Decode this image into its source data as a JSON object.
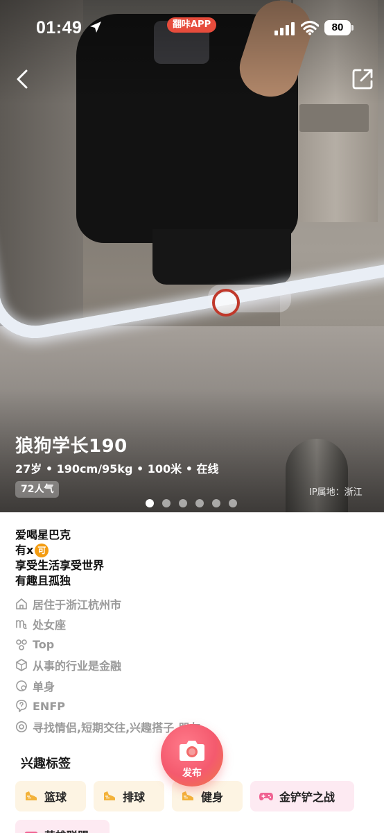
{
  "status_bar": {
    "time": "01:49",
    "app_pill": "翻咔APP",
    "battery": "80"
  },
  "profile": {
    "name": "狼狗学长190",
    "meta": "27岁 • 190cm/95kg • 100米 • 在线",
    "popularity": "72人气",
    "ip_location": "IP属地：浙江",
    "photo_count": 6,
    "photo_active_index": 0
  },
  "bio": {
    "line1": "爱喝星巴克",
    "line2_prefix": "有x",
    "line2_emoji": "可",
    "line3": "享受生活享受世界",
    "line4": "有趣且孤独"
  },
  "info": {
    "residence": "居住于浙江杭州市",
    "zodiac": "处女座",
    "role": "Top",
    "industry": "从事的行业是金融",
    "relationship": "单身",
    "mbti": "ENFP",
    "looking_for": "寻找情侣,短期交往,兴趣搭子,朋友"
  },
  "interests": {
    "title": "兴趣标签",
    "tags": [
      "篮球",
      "排球",
      "健身",
      "金铲铲之战",
      "英雄联盟"
    ]
  },
  "fab": {
    "label": "发布"
  },
  "colors": {
    "accent": "#f45a6e",
    "status_pill": "#e74c3c",
    "sport_tag_bg": "#fdf4e3",
    "game_tag_bg": "#fdeaf2",
    "muted_text": "#9a9a9a"
  },
  "icons": {
    "back": "chevron-left-icon",
    "share": "share-icon",
    "residence": "home-icon",
    "zodiac": "virgo-icon",
    "role": "role-icon",
    "industry": "industry-icon",
    "relationship": "heart-status-icon",
    "mbti": "question-bubble-icon",
    "looking_for": "target-icon",
    "sport": "sneaker-icon",
    "game": "gamepad-icon",
    "publish": "camera-icon"
  }
}
